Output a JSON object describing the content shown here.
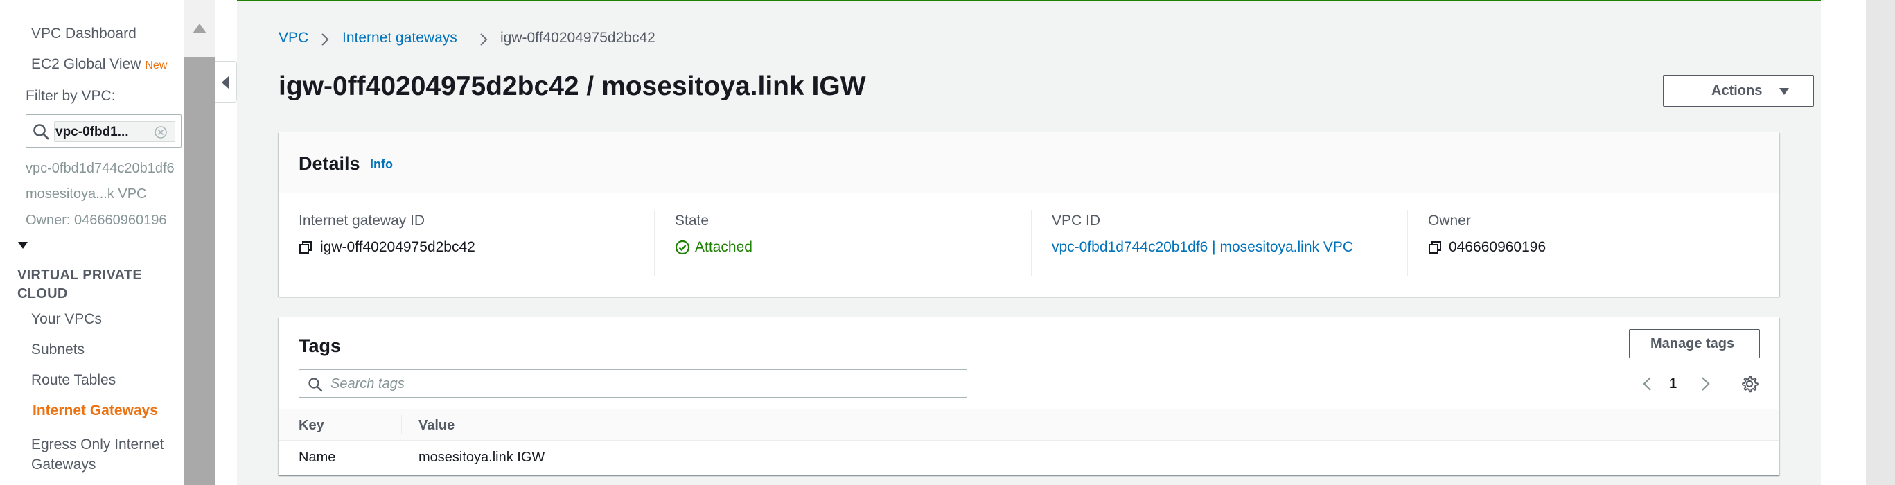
{
  "sidebar": {
    "vpc_dashboard": "VPC Dashboard",
    "ec2_global_view": "EC2 Global View",
    "new_badge": "New",
    "filter_label": "Filter by VPC:",
    "filter_token": "vpc-0fbd1...",
    "selected_vpc_id": "vpc-0fbd1d744c20b1df6",
    "selected_vpc_name": "mosesitoya...k VPC",
    "selected_vpc_owner": "Owner: 046660960196",
    "section_title": "VIRTUAL PRIVATE CLOUD",
    "items": [
      {
        "label": "Your VPCs"
      },
      {
        "label": "Subnets"
      },
      {
        "label": "Route Tables"
      },
      {
        "label": "Internet Gateways"
      },
      {
        "label": "Egress Only Internet Gateways"
      }
    ],
    "active_item": "Internet Gateways"
  },
  "breadcrumb": {
    "root": "VPC",
    "parent": "Internet gateways",
    "current": "igw-0ff40204975d2bc42"
  },
  "page_title": "igw-0ff40204975d2bc42 / mosesitoya.link IGW",
  "actions_label": "Actions",
  "details": {
    "title": "Details",
    "info": "Info",
    "fields": {
      "igw_label": "Internet gateway ID",
      "igw_value": "igw-0ff40204975d2bc42",
      "state_label": "State",
      "state_value": "Attached",
      "vpc_label": "VPC ID",
      "vpc_value": "vpc-0fbd1d744c20b1df6 | mosesitoya.link VPC",
      "owner_label": "Owner",
      "owner_value": "046660960196"
    }
  },
  "tags": {
    "title": "Tags",
    "manage_label": "Manage tags",
    "search_placeholder": "Search tags",
    "page_number": "1",
    "columns": {
      "key": "Key",
      "value": "Value"
    },
    "rows": [
      {
        "key": "Name",
        "value": "mosesitoya.link IGW"
      }
    ]
  },
  "colors": {
    "accent_orange": "#ec7211",
    "link_blue": "#0073bb",
    "success_green": "#1d8102",
    "page_bg": "#f2f3f3"
  },
  "icons": {
    "search": "search-icon",
    "clear": "clear-icon",
    "copy": "copy-icon",
    "status": "check-circle-icon",
    "settings": "gear-icon"
  }
}
